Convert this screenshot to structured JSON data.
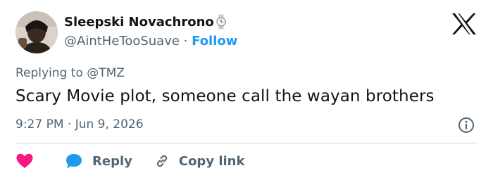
{
  "tweet": {
    "author_name": "Sleepski Novachrono",
    "handle": "@AintHeTooSuave",
    "separator": " · ",
    "follow_label": "Follow",
    "replying_to": "Replying to @TMZ",
    "text": "Scary Movie plot, someone call the wayan brothers",
    "timestamp": "9:27 PM · Jun 9, 2026"
  },
  "actions": {
    "reply_label": "Reply",
    "copy_link_label": "Copy link"
  },
  "icons": {
    "like": "heart-icon",
    "reply": "speech-bubble-icon",
    "copy": "link-icon",
    "info": "info-icon",
    "brand": "x-logo-icon",
    "badge": "watch-emoji-icon"
  },
  "colors": {
    "accent": "#1d9bf0",
    "like": "#f91880",
    "text": "#0f1419",
    "muted": "#536471",
    "divider": "#cfd9de"
  }
}
